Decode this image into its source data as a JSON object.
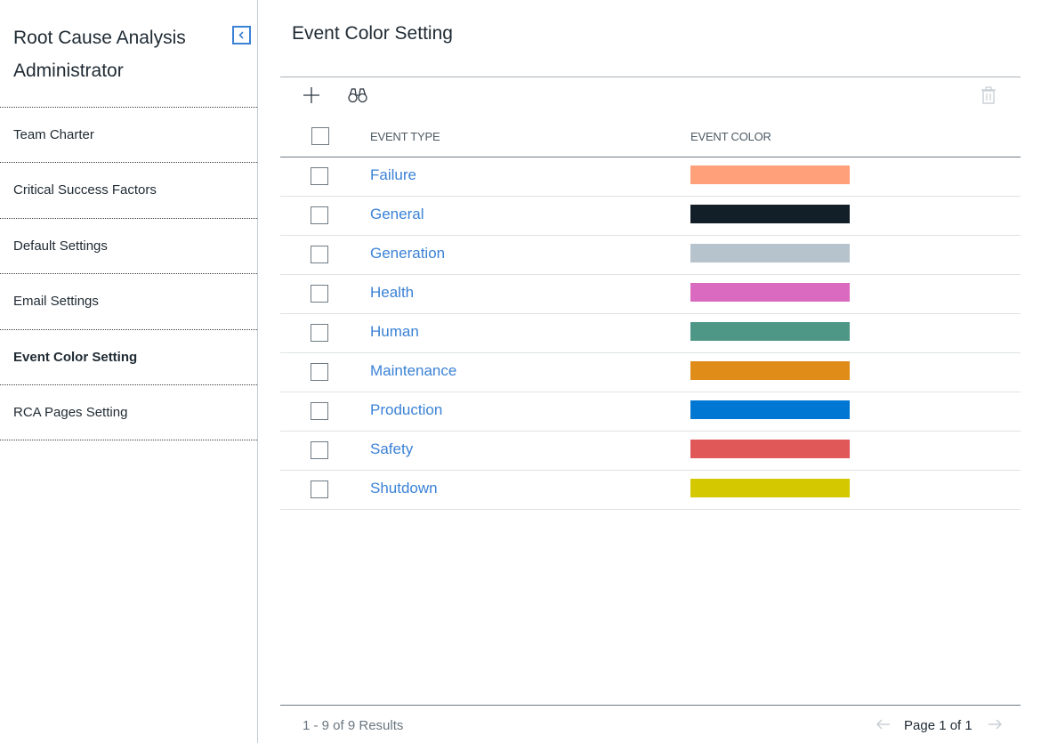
{
  "sidebar": {
    "title": "Root Cause Analysis Administrator",
    "items": [
      {
        "label": "Team Charter",
        "active": false
      },
      {
        "label": "Critical Success Factors",
        "active": false
      },
      {
        "label": "Default Settings",
        "active": false
      },
      {
        "label": "Email Settings",
        "active": false
      },
      {
        "label": "Event Color Setting",
        "active": true
      },
      {
        "label": "RCA Pages Setting",
        "active": false
      }
    ]
  },
  "main": {
    "title": "Event Color Setting",
    "toolbar": {
      "add_icon": "plus-icon",
      "find_icon": "binoculars-icon",
      "delete_icon": "trash-icon"
    },
    "grid": {
      "columns": {
        "type": "EVENT TYPE",
        "color": "EVENT COLOR"
      },
      "rows": [
        {
          "type": "Failure",
          "color": "#ffa07a"
        },
        {
          "type": "General",
          "color": "#121f28"
        },
        {
          "type": "Generation",
          "color": "#b6c3cc"
        },
        {
          "type": "Health",
          "color": "#da6abf"
        },
        {
          "type": "Human",
          "color": "#4e9787"
        },
        {
          "type": "Maintenance",
          "color": "#e08c19"
        },
        {
          "type": "Production",
          "color": "#0077d3"
        },
        {
          "type": "Safety",
          "color": "#e05858"
        },
        {
          "type": "Shutdown",
          "color": "#d4c900"
        }
      ]
    },
    "footer": {
      "results": "1 - 9 of 9 Results",
      "page_label": "Page 1 of 1"
    }
  },
  "colors": {
    "accent": "#3b82d6",
    "text": "#1f2a33",
    "muted": "#6a7680"
  }
}
